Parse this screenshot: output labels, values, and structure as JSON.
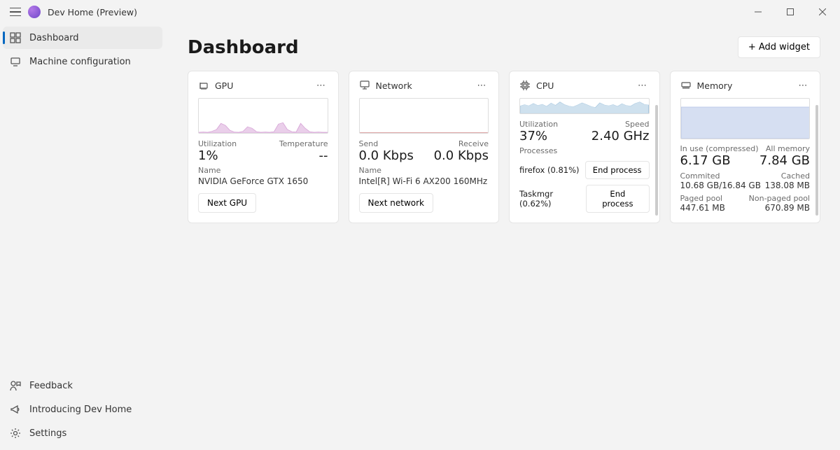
{
  "app_title": "Dev Home (Preview)",
  "sidebar": {
    "nav": [
      {
        "label": "Dashboard",
        "icon": "dashboard-icon",
        "selected": true
      },
      {
        "label": "Machine configuration",
        "icon": "config-icon",
        "selected": false
      }
    ],
    "footer": [
      {
        "label": "Feedback",
        "icon": "feedback-icon"
      },
      {
        "label": "Introducing Dev Home",
        "icon": "megaphone-icon"
      },
      {
        "label": "Settings",
        "icon": "gear-icon"
      }
    ]
  },
  "page": {
    "title": "Dashboard",
    "add_widget_label": "+ Add widget"
  },
  "widgets": {
    "gpu": {
      "title": "GPU",
      "util_label": "Utilization",
      "util_value": "1%",
      "temp_label": "Temperature",
      "temp_value": "--",
      "name_label": "Name",
      "name_value": "NVIDIA GeForce GTX 1650",
      "next_btn": "Next GPU"
    },
    "network": {
      "title": "Network",
      "send_label": "Send",
      "send_value": "0.0 Kbps",
      "recv_label": "Receive",
      "recv_value": "0.0 Kbps",
      "name_label": "Name",
      "name_value": "Intel[R] Wi-Fi 6 AX200 160MHz",
      "next_btn": "Next network"
    },
    "cpu": {
      "title": "CPU",
      "util_label": "Utilization",
      "util_value": "37%",
      "speed_label": "Speed",
      "speed_value": "2.40 GHz",
      "proc_label": "Processes",
      "processes": [
        {
          "name": "firefox (0.81%)",
          "btn": "End process"
        },
        {
          "name": "Taskmgr (0.62%)",
          "btn": "End process"
        }
      ]
    },
    "memory": {
      "title": "Memory",
      "inuse_label": "In use (compressed)",
      "inuse_value": "6.17 GB",
      "all_label": "All memory",
      "all_value": "7.84 GB",
      "committed_label": "Commited",
      "committed_value": "10.68 GB/16.84 GB",
      "cached_label": "Cached",
      "cached_value": "138.08 MB",
      "paged_label": "Paged pool",
      "paged_value": "447.61 MB",
      "nonpaged_label": "Non-paged pool",
      "nonpaged_value": "670.89 MB"
    }
  },
  "chart_data": [
    {
      "type": "area",
      "name": "gpu",
      "color": "#d8a7d8",
      "ylim": [
        0,
        100
      ],
      "values": [
        2,
        3,
        2,
        5,
        10,
        28,
        22,
        8,
        3,
        2,
        5,
        18,
        14,
        4,
        2,
        3,
        2,
        4,
        26,
        30,
        10,
        4,
        3,
        28,
        14,
        4,
        2,
        3,
        2,
        2
      ]
    },
    {
      "type": "line",
      "name": "network",
      "color": "#d08080",
      "ylim": [
        0,
        100
      ],
      "send": [
        1,
        1,
        1,
        1,
        1,
        1,
        1,
        1,
        1,
        1,
        1,
        1,
        1,
        1,
        1,
        1,
        1,
        1,
        1,
        1,
        1,
        1,
        1,
        1,
        1,
        1,
        1,
        1,
        1,
        1
      ],
      "recv": [
        0,
        0,
        0,
        0,
        0,
        0,
        0,
        0,
        0,
        0,
        0,
        0,
        0,
        0,
        0,
        0,
        0,
        0,
        0,
        0,
        0,
        0,
        0,
        0,
        0,
        0,
        0,
        0,
        0,
        0
      ]
    },
    {
      "type": "area",
      "name": "cpu",
      "color": "#a8c8e0",
      "ylim": [
        0,
        100
      ],
      "values": [
        50,
        60,
        52,
        68,
        54,
        62,
        48,
        70,
        55,
        78,
        60,
        50,
        45,
        58,
        72,
        60,
        48,
        40,
        72,
        58,
        52,
        60,
        48,
        66,
        54,
        50,
        68,
        78,
        62,
        58
      ]
    },
    {
      "type": "area",
      "name": "memory",
      "color": "#b4c4e8",
      "ylim": [
        0,
        100
      ],
      "values": [
        79,
        79,
        79,
        79,
        79,
        79,
        79,
        79,
        79,
        79,
        79,
        79,
        79,
        79,
        79,
        79,
        79,
        79,
        79,
        79,
        79,
        79,
        79,
        79,
        79,
        79,
        79,
        79,
        79,
        79
      ]
    }
  ]
}
